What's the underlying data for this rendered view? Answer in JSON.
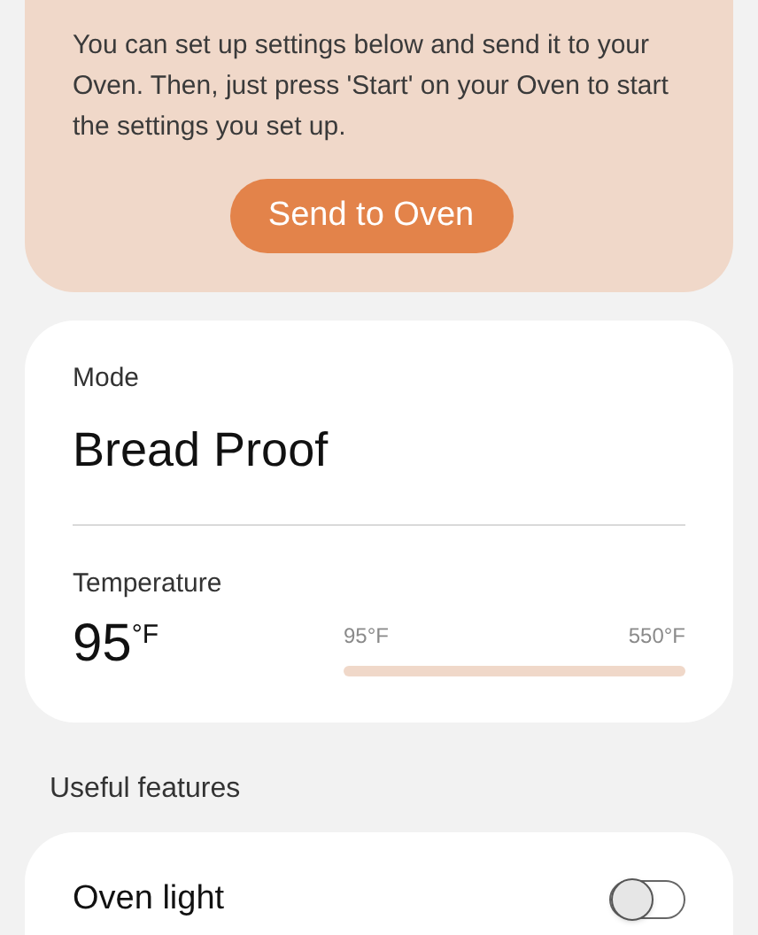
{
  "send_panel": {
    "description": "You can set up settings below and send it to your Oven. Then, just press 'Start' on your Oven to start the settings you set up.",
    "button": "Send to Oven"
  },
  "mode": {
    "label": "Mode",
    "value": "Bread Proof"
  },
  "temperature": {
    "label": "Temperature",
    "value": "95",
    "unit": "°F",
    "min_label": "95°F",
    "max_label": "550°F",
    "level": 0
  },
  "useful_features": {
    "title": "Useful features",
    "items": [
      {
        "label": "Oven light",
        "on": false
      }
    ]
  }
}
